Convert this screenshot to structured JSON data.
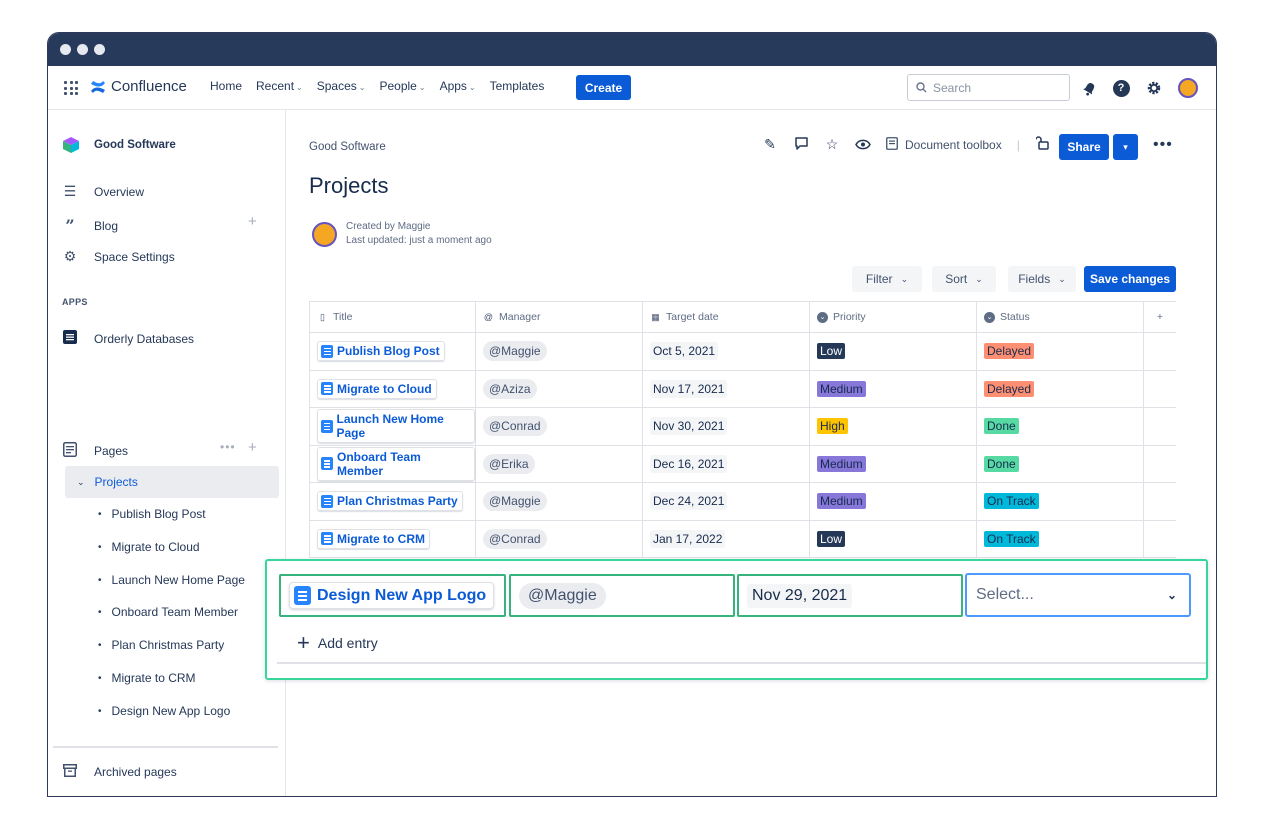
{
  "topnav": {
    "brand": "Confluence",
    "items": [
      {
        "label": "Home",
        "dropdown": false
      },
      {
        "label": "Recent",
        "dropdown": true
      },
      {
        "label": "Spaces",
        "dropdown": true
      },
      {
        "label": "People",
        "dropdown": true
      },
      {
        "label": "Apps",
        "dropdown": true
      },
      {
        "label": "Templates",
        "dropdown": false
      }
    ],
    "create_label": "Create",
    "search_placeholder": "Search"
  },
  "sidebar": {
    "space_name": "Good Software",
    "items": [
      {
        "label": "Overview",
        "icon": "overview-icon"
      },
      {
        "label": "Blog",
        "icon": "quote-icon"
      },
      {
        "label": "Space Settings",
        "icon": "gear-icon"
      }
    ],
    "apps_label": "APPS",
    "app_item": "Orderly Databases",
    "pages_label": "Pages",
    "current_page": "Projects",
    "children": [
      "Publish Blog Post",
      "Migrate to Cloud",
      "Launch New Home Page",
      "Onboard Team Member",
      "Plan Christmas Party",
      "Migrate to CRM",
      "Design New App Logo"
    ],
    "archived_label": "Archived pages"
  },
  "page": {
    "breadcrumb": "Good Software",
    "title": "Projects",
    "created_by": "Created by Maggie",
    "last_updated": "Last updated: just a moment ago",
    "document_toolbox": "Document toolbox",
    "share_label": "Share"
  },
  "controls": {
    "filter": "Filter",
    "sort": "Sort",
    "fields": "Fields",
    "save": "Save changes"
  },
  "table": {
    "headers": [
      "Title",
      "Manager",
      "Target date",
      "Priority",
      "Status"
    ],
    "rows": [
      {
        "title": "Publish Blog Post",
        "manager": "@Maggie",
        "date": "Oct 5, 2021",
        "priority": "Low",
        "status": "Delayed"
      },
      {
        "title": "Migrate to Cloud",
        "manager": "@Aziza",
        "date": "Nov 17, 2021",
        "priority": "Medium",
        "status": "Delayed"
      },
      {
        "title": "Launch New Home Page",
        "manager": "@Conrad",
        "date": "Nov 30, 2021",
        "priority": "High",
        "status": "Done"
      },
      {
        "title": "Onboard Team Member",
        "manager": "@Erika",
        "date": "Dec 16, 2021",
        "priority": "Medium",
        "status": "Done"
      },
      {
        "title": "Plan Christmas Party",
        "manager": "@Maggie",
        "date": "Dec 24, 2021",
        "priority": "Medium",
        "status": "On Track"
      },
      {
        "title": "Migrate to CRM",
        "manager": "@Conrad",
        "date": "Jan 17, 2022",
        "priority": "Low",
        "status": "On Track"
      }
    ]
  },
  "lozenge_colors": {
    "Low": {
      "bg": "#253858",
      "fg": "#ffffff"
    },
    "Medium": {
      "bg": "#8777d9",
      "fg": "#172b4d"
    },
    "High": {
      "bg": "#ffc400",
      "fg": "#172b4d"
    },
    "Delayed": {
      "bg": "#ff8f73",
      "fg": "#172b4d"
    },
    "Done": {
      "bg": "#57d9a3",
      "fg": "#172b4d"
    },
    "On Track": {
      "bg": "#00b8d9",
      "fg": "#172b4d"
    }
  },
  "new_entry": {
    "title": "Design New App Logo",
    "manager": "@Maggie",
    "date": "Nov 29, 2021",
    "status_placeholder": "Select...",
    "add_entry_label": "Add entry"
  },
  "colors": {
    "brand_blue": "#0c5bd6",
    "highlight_green": "#37d69a",
    "titlebar": "#283a5b"
  }
}
